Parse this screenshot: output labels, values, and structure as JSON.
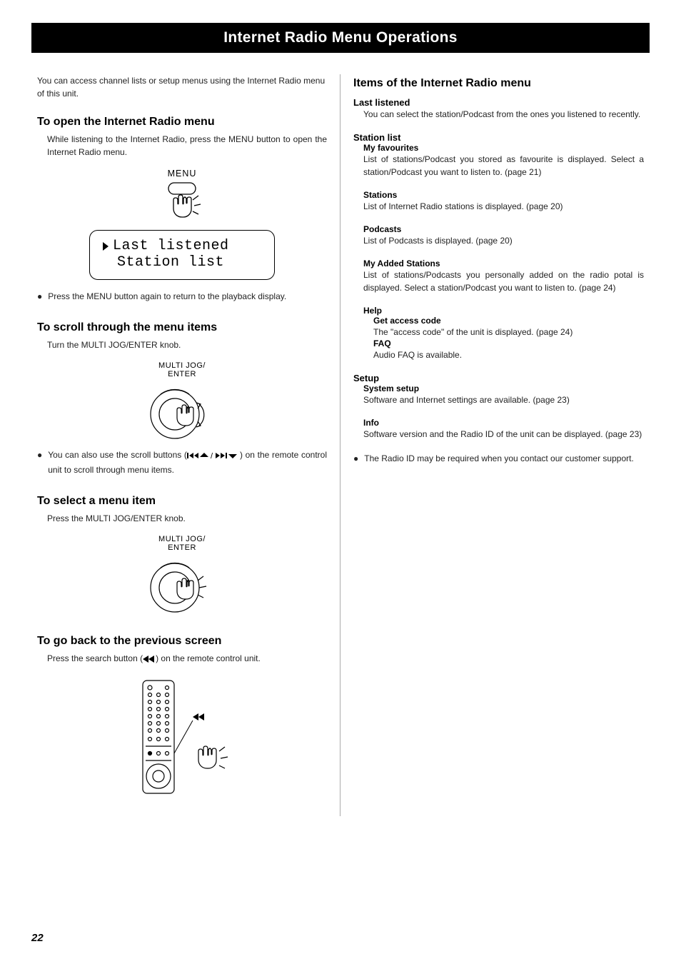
{
  "title": "Internet Radio Menu Operations",
  "left": {
    "intro": "You can access channel lists or setup menus using the Internet Radio menu of this unit.",
    "s1": {
      "heading": "To open the Internet Radio menu",
      "body": "While listening to the Internet Radio, press the MENU button to open the Internet Radio menu.",
      "menu_label": "MENU",
      "lcd_line1": "Last listened",
      "lcd_line2": "Station list",
      "bullet": "Press the MENU button again to return to the playback display."
    },
    "s2": {
      "heading": "To scroll through the menu items",
      "body": "Turn the MULTI JOG/ENTER knob.",
      "jog_label1": "MULTI JOG/",
      "jog_label2": "ENTER",
      "bullet_pre": "You can also use the scroll buttons (",
      "bullet_post": ") on the remote control unit to scroll through menu items."
    },
    "s3": {
      "heading": "To select a menu item",
      "body": "Press the MULTI JOG/ENTER knob.",
      "jog_label1": "MULTI JOG/",
      "jog_label2": "ENTER"
    },
    "s4": {
      "heading": "To go back to the previous screen",
      "body_pre": "Press the search button (",
      "body_post": ") on the remote control unit."
    }
  },
  "right": {
    "heading": "Items of the Internet Radio menu",
    "last_listened": {
      "title": "Last listened",
      "body": "You can select the station/Podcast from the ones you listened to recently."
    },
    "station_list": {
      "title": "Station list",
      "my_favourites": {
        "title": "My favourites",
        "body": "List of stations/Podcast you stored as favourite is displayed. Select a station/Podcast you want to listen to. (page 21)"
      },
      "stations": {
        "title": "Stations",
        "body": "List of Internet Radio stations is displayed. (page 20)"
      },
      "podcasts": {
        "title": "Podcasts",
        "body": "List of Podcasts is displayed. (page 20)"
      },
      "my_added": {
        "title": "My Added Stations",
        "body": "List of stations/Podcasts you personally added on the radio potal is displayed. Select a station/Podcast you want to listen to. (page 24)"
      },
      "help": {
        "title": "Help",
        "get_access": {
          "title": "Get access code",
          "body": "The \"access code\" of the unit is displayed. (page 24)"
        },
        "faq": {
          "title": "FAQ",
          "body": "Audio FAQ is available."
        }
      }
    },
    "setup": {
      "title": "Setup",
      "system_setup": {
        "title": "System setup",
        "body": "Software and Internet settings are available. (page 23)"
      },
      "info": {
        "title": "Info",
        "body": "Software version and the Radio ID of the unit can be displayed. (page 23)"
      }
    },
    "radio_id_note": "The Radio ID may be required when you contact our customer support."
  },
  "page_number": "22"
}
